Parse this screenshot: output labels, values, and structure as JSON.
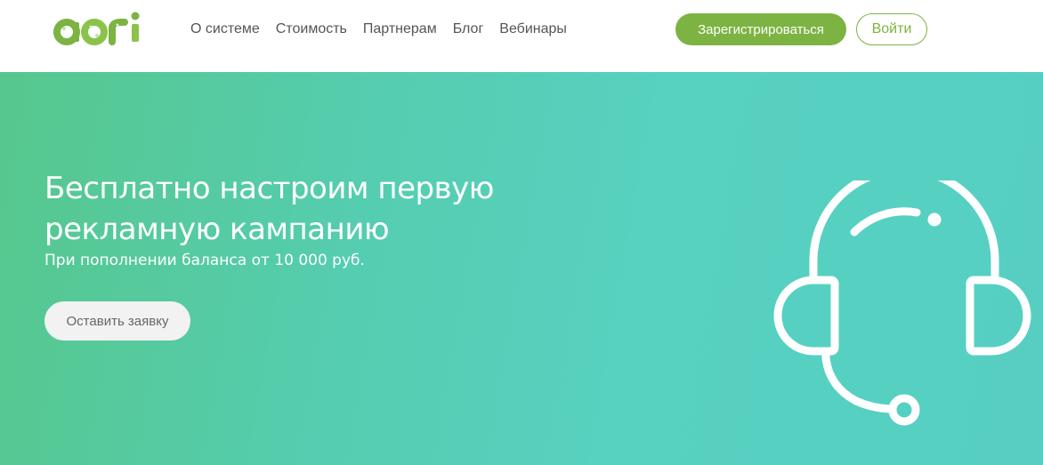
{
  "header": {
    "logo_text": "aori",
    "nav": [
      "О системе",
      "Стоимость",
      "Партнерам",
      "Блог",
      "Вебинары"
    ],
    "register_label": "Зарегистрироваться",
    "login_label": "Войти"
  },
  "hero": {
    "title_line1": "Бесплатно настроим первую",
    "title_line2": "рекламную кампанию",
    "subtitle": "При пополнении баланса от 10 000 руб.",
    "request_label": "Оставить заявку"
  },
  "colors": {
    "brand_green": "#7cb342",
    "hero_start": "#56c78d",
    "hero_end": "#56cfc2"
  },
  "icons": {
    "hero_illustration": "headset-icon"
  }
}
